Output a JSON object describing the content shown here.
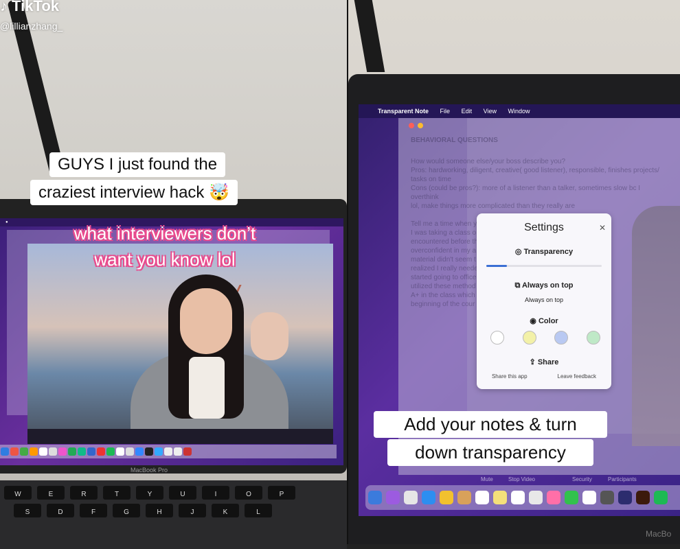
{
  "tiktok": {
    "logo": "TikTok",
    "handle": "@lillianzhang_"
  },
  "left": {
    "caption_line1": "GUYS I just found the",
    "caption_line2": "craziest interview hack 🤯",
    "overlay_line1": "what interviewers don’t",
    "overlay_line2": "want you know lol",
    "laptop_brand": "MacBook Pro",
    "keyboard_rows": [
      [
        "W",
        "E",
        "R",
        "T",
        "Y",
        "U",
        "I",
        "O",
        "P"
      ],
      [
        "S",
        "D",
        "F",
        "G",
        "H",
        "J",
        "K",
        "L"
      ]
    ]
  },
  "right": {
    "menubar": {
      "app": "Transparent Note",
      "items": [
        "File",
        "Edit",
        "View",
        "Window"
      ]
    },
    "notes": {
      "heading": "BEHAVIORAL QUESTIONS",
      "lines": [
        "How would someone else/your boss describe you?",
        "Pros: hardworking, diligent, creative( good listener), responsible, finishes projects/",
        "tasks on time",
        "Cons (could be pros?): more of a listener than a talker, sometimes slow bc I overthink",
        "lol, make things more complicated than they really are",
        "",
        "Tell me a time when you ... stake and overcame",
        "I was taking a class o ... nd content that I neve",
        "encountered before th ... tics. At first, I was",
        "overconfident in my a ... h school and the",
        "material didn't seem t ... m score back that I",
        "realized I really neede ... arning the material. I",
        "started going to office ... rategies for studying.",
        "utilized these method ... pt. I ended up with an",
        "A+ in the class which ... lance near the",
        "beginning of the cour"
      ]
    },
    "settings": {
      "title": "Settings",
      "transparency_label": "Transparency",
      "transparency_value": 0.18,
      "always_on_top_label": "Always on top",
      "always_on_top_sub": "Always on top",
      "color_label": "Color",
      "swatches": [
        "#ffffff",
        "#f3f1a8",
        "#b9c9f2",
        "#bfe9c7"
      ],
      "share_label": "Share",
      "share_link": "Share this app",
      "feedback_link": "Leave feedback"
    },
    "zoom": {
      "mute": "Mute",
      "stop_video": "Stop Video",
      "security": "Security",
      "participants": "Participants"
    },
    "caption_line1": "Add your notes & turn",
    "caption_line2": "down transparency",
    "laptop_brand": "MacBo"
  }
}
